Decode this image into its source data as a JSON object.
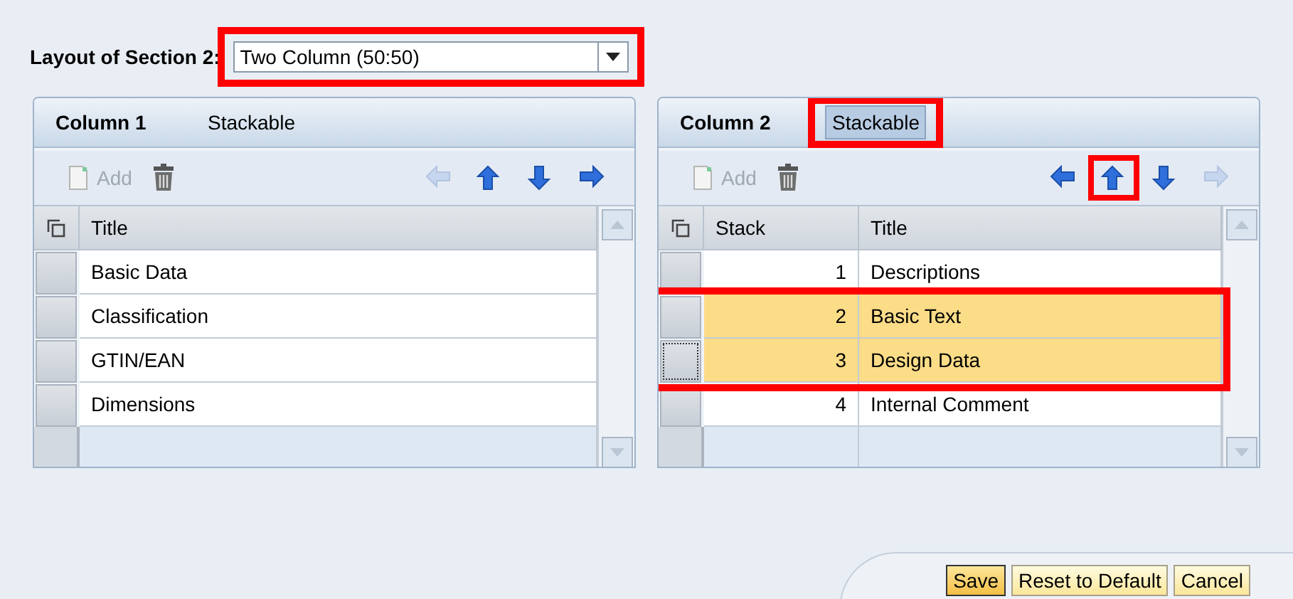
{
  "layout_field": {
    "label": "Layout of Section 2:",
    "value": "Two Column (50:50)",
    "callout": true
  },
  "columns": [
    {
      "title": "Column 1",
      "stackable": {
        "label": "Stackable",
        "selected": false,
        "callout": false
      },
      "toolbar": {
        "add": {
          "label": "Add",
          "disabled": true
        },
        "delete": {
          "disabled": false
        },
        "moves": [
          {
            "kind": "left",
            "disabled": true,
            "callout": false
          },
          {
            "kind": "up",
            "disabled": false,
            "callout": false
          },
          {
            "kind": "down",
            "disabled": false,
            "callout": false
          },
          {
            "kind": "right",
            "disabled": false,
            "callout": false
          }
        ]
      },
      "table": {
        "columns": [
          {
            "label": "Title",
            "kind": "text"
          }
        ],
        "rows": [
          {
            "cells": [
              "Basic Data"
            ],
            "selected": false,
            "focused": false,
            "callout": false
          },
          {
            "cells": [
              "Classification"
            ],
            "selected": false,
            "focused": false,
            "callout": false
          },
          {
            "cells": [
              "GTIN/EAN"
            ],
            "selected": false,
            "focused": false,
            "callout": false
          },
          {
            "cells": [
              "Dimensions"
            ],
            "selected": false,
            "focused": false,
            "callout": false
          }
        ]
      }
    },
    {
      "title": "Column 2",
      "stackable": {
        "label": "Stackable",
        "selected": true,
        "callout": true
      },
      "toolbar": {
        "add": {
          "label": "Add",
          "disabled": true
        },
        "delete": {
          "disabled": false
        },
        "moves": [
          {
            "kind": "left",
            "disabled": false,
            "callout": false
          },
          {
            "kind": "up",
            "disabled": false,
            "callout": true
          },
          {
            "kind": "down",
            "disabled": false,
            "callout": false
          },
          {
            "kind": "right",
            "disabled": true,
            "callout": false
          }
        ]
      },
      "table": {
        "columns": [
          {
            "label": "Stack",
            "kind": "number"
          },
          {
            "label": "Title",
            "kind": "text"
          }
        ],
        "rows": [
          {
            "cells": [
              "1",
              "Descriptions"
            ],
            "selected": false,
            "focused": false,
            "callout": false
          },
          {
            "cells": [
              "2",
              "Basic Text"
            ],
            "selected": true,
            "focused": false,
            "callout": true
          },
          {
            "cells": [
              "3",
              "Design Data"
            ],
            "selected": true,
            "focused": true,
            "callout": true
          },
          {
            "cells": [
              "4",
              "Internal Comment"
            ],
            "selected": false,
            "focused": false,
            "callout": false
          }
        ]
      }
    }
  ],
  "buttons": [
    {
      "label": "Save",
      "emphasized": true
    },
    {
      "label": "Reset to Default",
      "emphasized": false
    },
    {
      "label": "Cancel",
      "emphasized": false
    }
  ]
}
